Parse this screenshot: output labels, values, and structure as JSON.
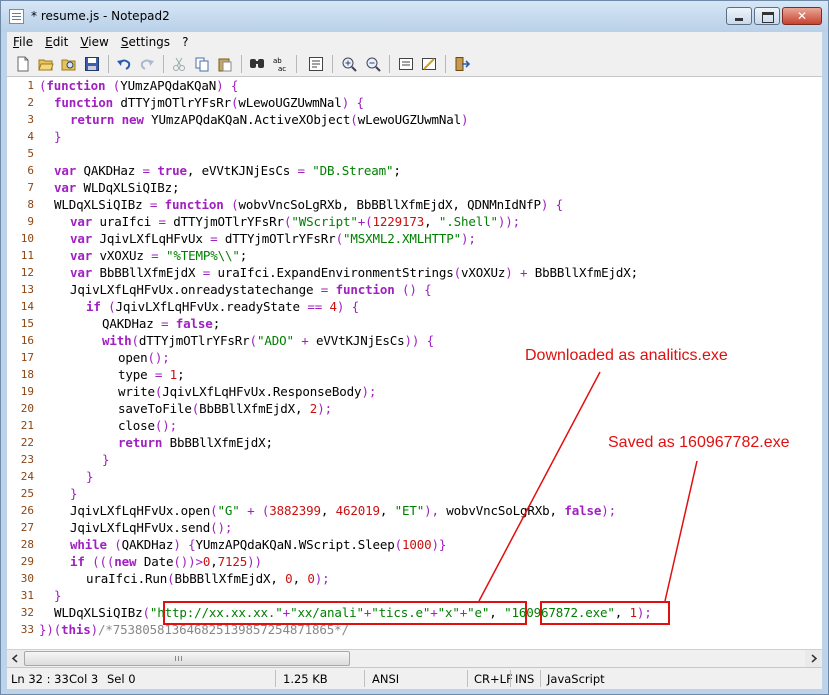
{
  "window": {
    "title": "* resume.js - Notepad2"
  },
  "menu": [
    "File",
    "Edit",
    "View",
    "Settings",
    "?"
  ],
  "toolbar": {
    "icons": [
      "new-file-icon",
      "open-icon",
      "browse-icon",
      "save-icon",
      "undo-icon",
      "redo-icon",
      "cut-icon",
      "copy-icon",
      "paste-icon",
      "find-icon",
      "replace-icon",
      "word-wrap-icon",
      "zoom-in-icon",
      "zoom-out-icon",
      "select-scheme-icon",
      "customize-scheme-icon",
      "exit-icon"
    ]
  },
  "editor": {
    "line_numbers": [
      "1",
      "2",
      "3",
      "4",
      "5",
      "6",
      "7",
      "8",
      "9",
      "10",
      "11",
      "12",
      "13",
      "14",
      "15",
      "16",
      "17",
      "18",
      "19",
      "20",
      "21",
      "22",
      "23",
      "24",
      "25",
      "26",
      "27",
      "28",
      "29",
      "30",
      "31",
      "32",
      "33"
    ]
  },
  "annotations": {
    "downloaded": "Downloaded as analitics.exe",
    "saved": "Saved as 160967782.exe"
  },
  "status": {
    "position": "Ln 32 : 33",
    "col": "Col 3",
    "sel": "Sel 0",
    "size": "1.25 KB",
    "encoding": "ANSI",
    "eol": "CR+LF",
    "mode": "INS",
    "lexer": "JavaScript"
  },
  "colors": {
    "keyword": "#a020c0",
    "string": "#008000",
    "number": "#cc1010",
    "annotation": "#e01010",
    "line_number": "#8b4513"
  }
}
